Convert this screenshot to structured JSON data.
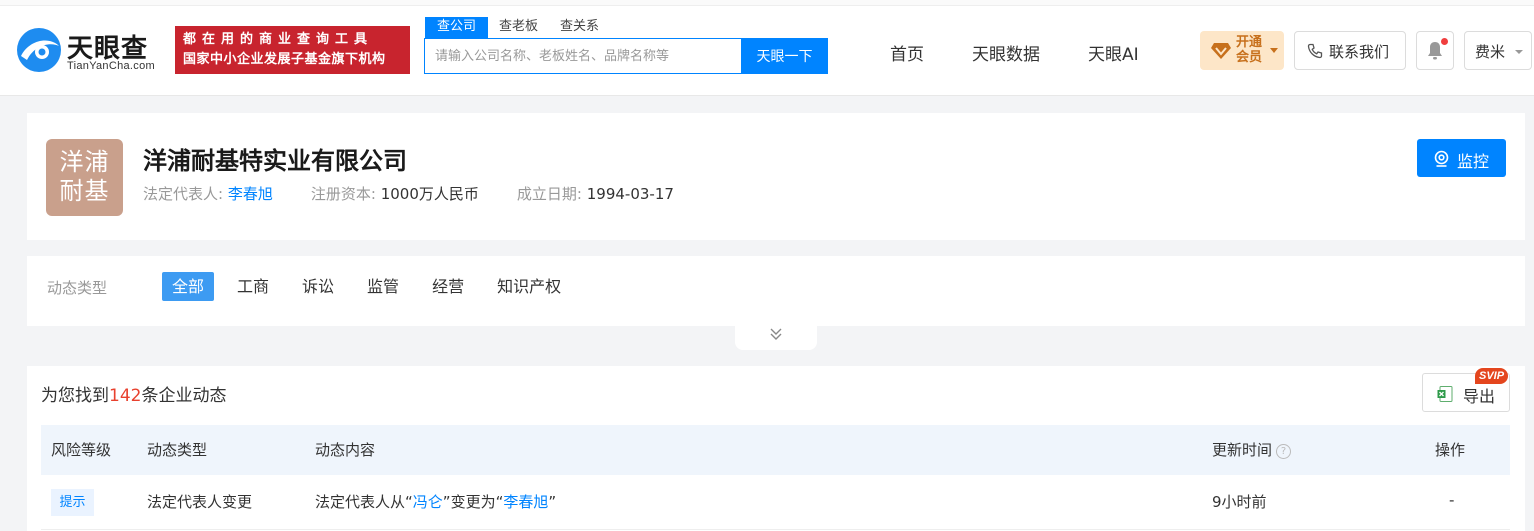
{
  "header": {
    "logo": {
      "title": "天眼查",
      "subtitle": "TianYanCha.com"
    },
    "slogan": {
      "line1": "都在用的商业查询工具",
      "line2": "国家中小企业发展子基金旗下机构"
    },
    "search": {
      "tabs": [
        "查公司",
        "查老板",
        "查关系"
      ],
      "active_tab": "查公司",
      "placeholder": "请输入公司名称、老板姓名、品牌名称等",
      "button": "天眼一下"
    },
    "nav": [
      "首页",
      "天眼数据",
      "天眼AI"
    ],
    "vip": {
      "line1": "开通",
      "line2": "会员",
      "icon": "diamond-icon"
    },
    "contact": "联系我们",
    "user": "费米"
  },
  "company": {
    "logo_text_line1": "洋浦",
    "logo_text_line2": "耐基",
    "logo_color": "#c9a08c",
    "name": "洋浦耐基特实业有限公司",
    "legal_rep_label": "法定代表人:",
    "legal_rep": "李春旭",
    "capital_label": "注册资本:",
    "capital": "1000万人民币",
    "founded_label": "成立日期:",
    "founded": "1994-03-17",
    "monitor_button": "监控"
  },
  "filter": {
    "label": "动态类型",
    "tabs": [
      "全部",
      "工商",
      "诉讼",
      "监管",
      "经营",
      "知识产权"
    ],
    "active": "全部"
  },
  "results": {
    "prefix": "为您找到",
    "count": "142",
    "suffix": "条企业动态",
    "export_button": "导出",
    "export_badge": "SVIP",
    "columns": [
      "风险等级",
      "动态类型",
      "动态内容",
      "更新时间",
      "操作"
    ],
    "rows": [
      {
        "risk": "提示",
        "type": "法定代表人变更",
        "content_pre": "法定代表人从“",
        "content_from": "冯仑",
        "content_mid": "”变更为“",
        "content_to": "李春旭",
        "content_post": "”",
        "time": "9小时前",
        "action": "-"
      }
    ]
  },
  "colors": {
    "accent": "#0084ff",
    "brand_red": "#c8242e",
    "count_red": "#e8412e"
  }
}
